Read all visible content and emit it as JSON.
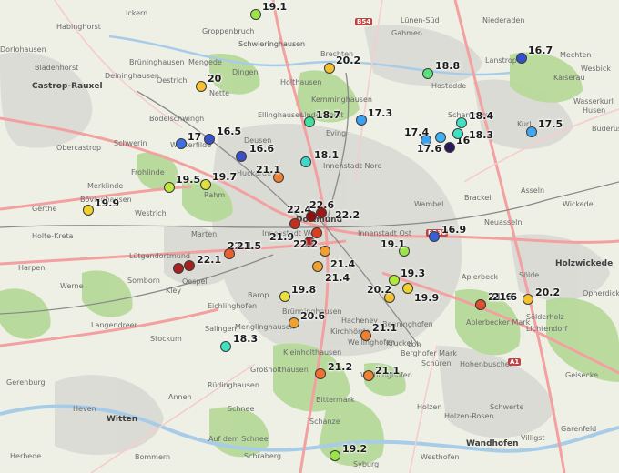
{
  "places": [
    {
      "label": "Lünen-Süd"
    },
    {
      "label": "Niederaden"
    },
    {
      "label": "Gahmen"
    },
    {
      "label": "Brechten"
    },
    {
      "label": "Habinghorst"
    },
    {
      "label": "Ickern"
    },
    {
      "label": "Groppenbruch"
    },
    {
      "label": "Schwieringhausen"
    },
    {
      "label": "Dingen"
    },
    {
      "label": "Dorlohausen"
    },
    {
      "label": "Bladenhorst"
    },
    {
      "label": "Brüninghausen"
    },
    {
      "label": "Mengede"
    },
    {
      "label": "Castrop-Rauxel"
    },
    {
      "label": "Deininghausen"
    },
    {
      "label": "Oestrich"
    },
    {
      "label": "Nette"
    },
    {
      "label": "Holthausen"
    },
    {
      "label": "Kemminghausen"
    },
    {
      "label": "Hostedde"
    },
    {
      "label": "Lanstrop"
    },
    {
      "label": "Mechten"
    },
    {
      "label": "Wesbick"
    },
    {
      "label": "Kaiserau"
    },
    {
      "label": "Wasserkurl"
    },
    {
      "label": "Bodelschwingh"
    },
    {
      "label": "Ellinghausen"
    },
    {
      "label": "Lindenhorst"
    },
    {
      "label": "Scharnhorst"
    },
    {
      "label": "Kurl"
    },
    {
      "label": "Husen"
    },
    {
      "label": "Buderus"
    },
    {
      "label": "Westerfilde"
    },
    {
      "label": "Deusen"
    },
    {
      "label": "Eving"
    },
    {
      "label": "Schwerin"
    },
    {
      "label": "Obercastrop"
    },
    {
      "label": "Frohlinde"
    },
    {
      "label": "Merklinde"
    },
    {
      "label": "Bövinghausen"
    },
    {
      "label": "Huckarde"
    },
    {
      "label": "Rahm"
    },
    {
      "label": "Innenstadt Nord"
    },
    {
      "label": "Wambel"
    },
    {
      "label": "Brackel"
    },
    {
      "label": "Asseln"
    },
    {
      "label": "Wickede"
    },
    {
      "label": "Gerthe"
    },
    {
      "label": "Westrich"
    },
    {
      "label": "Marten"
    },
    {
      "label": "Dortmund"
    },
    {
      "label": "Innenstadt West"
    },
    {
      "label": "Innenstadt Ost"
    },
    {
      "label": "Neuasseln"
    },
    {
      "label": "Holte-Kreta"
    },
    {
      "label": "Lütgendortmund"
    },
    {
      "label": "Harpen"
    },
    {
      "label": "Werne"
    },
    {
      "label": "Somborn"
    },
    {
      "label": "Holzwickede"
    },
    {
      "label": "Kley"
    },
    {
      "label": "Oespel"
    },
    {
      "label": "Barop"
    },
    {
      "label": "Eichlinghofen"
    },
    {
      "label": "Aplerbeck"
    },
    {
      "label": "Sölde"
    },
    {
      "label": "Opherdicke"
    },
    {
      "label": "Langendreer"
    },
    {
      "label": "Stockum"
    },
    {
      "label": "Menglinghausen"
    },
    {
      "label": "Brünninghausen"
    },
    {
      "label": "Hacheney"
    },
    {
      "label": "Benninghofen"
    },
    {
      "label": "Aplerbecker Mark"
    },
    {
      "label": "Sölderholz"
    },
    {
      "label": "Lichtendorf"
    },
    {
      "label": "Salingen"
    },
    {
      "label": "Kirchhörde"
    },
    {
      "label": "Wellinghofen"
    },
    {
      "label": "Loh"
    },
    {
      "label": "Berghofer Mark"
    },
    {
      "label": "Großholthausen"
    },
    {
      "label": "Kleinholthausen"
    },
    {
      "label": "Rüdinghausen"
    },
    {
      "label": "Witten"
    },
    {
      "label": "Annen"
    },
    {
      "label": "Heven"
    },
    {
      "label": "Bommern"
    },
    {
      "label": "Schnee"
    },
    {
      "label": "Auf dem Schnee"
    },
    {
      "label": "Schraberg"
    },
    {
      "label": "Schanze"
    },
    {
      "label": "Bittermark"
    },
    {
      "label": "Wichlinghofen"
    },
    {
      "label": "Holzen"
    },
    {
      "label": "Holzen-Rosen"
    },
    {
      "label": "Schwerte"
    },
    {
      "label": "Geisecke"
    },
    {
      "label": "Villigst"
    },
    {
      "label": "Wandhofen"
    },
    {
      "label": "Westhofen"
    },
    {
      "label": "Garenfeld"
    },
    {
      "label": "Herbede"
    },
    {
      "label": "Syburg"
    },
    {
      "label": "Gerenburg"
    },
    {
      "label": "Kruckel"
    },
    {
      "label": "Schüren"
    },
    {
      "label": "Hohenbuschei"
    },
    {
      "label": "Schwieringhausen"
    }
  ],
  "measurements": [
    {
      "value": "19.1",
      "color": "#9be54a"
    },
    {
      "value": "20.2",
      "color": "#f2c230"
    },
    {
      "value": "17.3",
      "color": "#3aa0f0"
    },
    {
      "value": "18.8",
      "color": "#5ae07a"
    },
    {
      "value": "16.7",
      "color": "#3050d0"
    },
    {
      "value": "20",
      "color": "#f2c230"
    },
    {
      "value": "18.7",
      "color": "#40e0a0"
    },
    {
      "value": "18.4",
      "color": "#40e0c0"
    },
    {
      "value": "17.4",
      "color": "#3aa0f0"
    },
    {
      "value": "17.6",
      "color": "#40b0f0"
    },
    {
      "value": "16",
      "color": "#2a1a5a"
    },
    {
      "value": "18.3",
      "color": "#40e0c0"
    },
    {
      "value": "17.5",
      "color": "#40a8f0"
    },
    {
      "value": "17",
      "color": "#4070e0"
    },
    {
      "value": "16.5",
      "color": "#3a50c8"
    },
    {
      "value": "16.6",
      "color": "#3a50c8"
    },
    {
      "value": "18.1",
      "color": "#40d8c8"
    },
    {
      "value": "21.1",
      "color": "#f08030"
    },
    {
      "value": "19.5",
      "color": "#c0e840"
    },
    {
      "value": "19.7",
      "color": "#e0e040"
    },
    {
      "value": "19.9",
      "color": "#f0d030"
    },
    {
      "value": "22.4",
      "color": "#c03020"
    },
    {
      "value": "22.6",
      "color": "#901010"
    },
    {
      "value": "22.2",
      "color": "#a01818"
    },
    {
      "value": "21.9",
      "color": "#d84020"
    },
    {
      "value": "22.2",
      "color": "#a01818"
    },
    {
      "value": "22.1",
      "color": "#a82020"
    },
    {
      "value": "16.9",
      "color": "#3a60d8"
    },
    {
      "value": "21.6",
      "color": "#e05030"
    },
    {
      "value": "19.1",
      "color": "#9be54a"
    },
    {
      "value": "21.5",
      "color": "#e86030"
    },
    {
      "value": "22.1",
      "color": "#a82020"
    },
    {
      "value": "21.4",
      "color": "#f0a030"
    },
    {
      "value": "21.4",
      "color": "#f0a030"
    },
    {
      "value": "19.3",
      "color": "#b0e840"
    },
    {
      "value": "20.2",
      "color": "#f2c230"
    },
    {
      "value": "19.9",
      "color": "#f0d030"
    },
    {
      "value": "19.8",
      "color": "#e8e040"
    },
    {
      "value": "21.6",
      "color": "#e05030"
    },
    {
      "value": "20.2",
      "color": "#f2c230"
    },
    {
      "value": "20.6",
      "color": "#f0a030"
    },
    {
      "value": "21.1",
      "color": "#f08030"
    },
    {
      "value": "18.3",
      "color": "#40e0c0"
    },
    {
      "value": "21.2",
      "color": "#f07030"
    },
    {
      "value": "21.1",
      "color": "#f08030"
    },
    {
      "value": "19.2",
      "color": "#9be54a"
    }
  ],
  "shields": [
    {
      "label": "B54"
    },
    {
      "label": "B236"
    },
    {
      "label": "A1"
    }
  ],
  "colors": {
    "land": "#eef0e6",
    "forest": "#b7d99a",
    "urban": "#d9d9d4",
    "road_major": "#f3a0a0",
    "rail": "#8a8a8a",
    "water": "#a8cce8"
  }
}
